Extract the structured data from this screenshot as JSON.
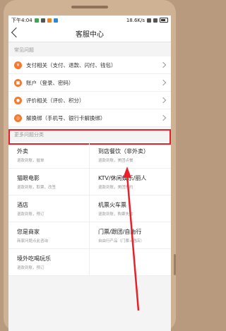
{
  "status_bar": {
    "time": "下午4:04",
    "speed": "18.6K/s"
  },
  "nav": {
    "title": "客服中心"
  },
  "faq": {
    "section_title": "常见问题",
    "items": [
      {
        "label": "支付相关（支付、退款、闪付、钱包）"
      },
      {
        "label": "账户（登录、密码）"
      },
      {
        "label": "评价相关（评价、积分）"
      },
      {
        "label": "解换绑（手机号、银行卡解换绑）"
      }
    ]
  },
  "more": {
    "section_title": "更多问题分类",
    "categories": [
      {
        "title": "外卖",
        "subtitle": "退款到账，催单"
      },
      {
        "title": "到店餐饮（非外卖）",
        "subtitle": "退款到账，美团点餐"
      },
      {
        "title": "猫眼电影",
        "subtitle": "退款到账，取票，改签"
      },
      {
        "title": "KTV/休闲娱乐/丽人",
        "subtitle": "退款到账，美团预约"
      },
      {
        "title": "酒店",
        "subtitle": "退款到账，预订"
      },
      {
        "title": "机票火车票",
        "subtitle": "退款到账，购票失败"
      },
      {
        "title": "您是商家",
        "subtitle": "商家问题点此咨询"
      },
      {
        "title": "门票/跟团/自由行",
        "subtitle": "自由行产品（门票+酒店）"
      },
      {
        "title": "境外吃喝玩乐",
        "subtitle": "退款到账，预订"
      },
      {
        "title": "",
        "subtitle": ""
      }
    ]
  },
  "colors": {
    "accent": "#f47a30",
    "highlight": "#e8202a"
  }
}
